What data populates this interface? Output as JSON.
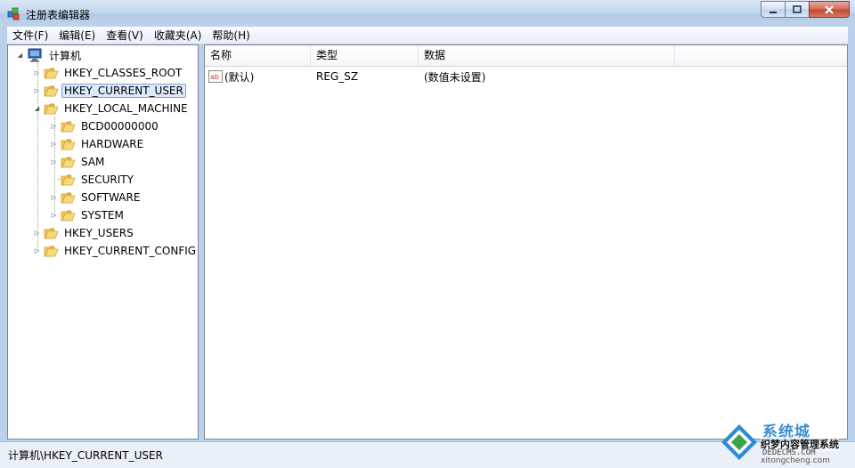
{
  "window": {
    "title": "注册表编辑器",
    "controls": {
      "minimize_icon": "minimize-icon",
      "maximize_icon": "maximize-icon",
      "close_icon": "close-icon"
    }
  },
  "menu": {
    "items": [
      {
        "label": "文件(F)"
      },
      {
        "label": "编辑(E)"
      },
      {
        "label": "查看(V)"
      },
      {
        "label": "收藏夹(A)"
      },
      {
        "label": "帮助(H)"
      }
    ]
  },
  "tree": {
    "root": {
      "label": "计算机",
      "icon": "computer-icon"
    },
    "nodes": [
      {
        "label": "HKEY_CLASSES_ROOT",
        "level": 1,
        "expander": "collapsed"
      },
      {
        "label": "HKEY_CURRENT_USER",
        "level": 1,
        "expander": "collapsed",
        "selected": true
      },
      {
        "label": "HKEY_LOCAL_MACHINE",
        "level": 1,
        "expander": "expanded"
      },
      {
        "label": "BCD00000000",
        "level": 2,
        "expander": "collapsed"
      },
      {
        "label": "HARDWARE",
        "level": 2,
        "expander": "collapsed"
      },
      {
        "label": "SAM",
        "level": 2,
        "expander": "collapsed"
      },
      {
        "label": "SECURITY",
        "level": 2,
        "expander": "none"
      },
      {
        "label": "SOFTWARE",
        "level": 2,
        "expander": "collapsed"
      },
      {
        "label": "SYSTEM",
        "level": 2,
        "expander": "collapsed"
      },
      {
        "label": "HKEY_USERS",
        "level": 1,
        "expander": "collapsed"
      },
      {
        "label": "HKEY_CURRENT_CONFIG",
        "level": 1,
        "expander": "collapsed"
      }
    ]
  },
  "list": {
    "columns": [
      {
        "label": "名称"
      },
      {
        "label": "类型"
      },
      {
        "label": "数据"
      }
    ],
    "rows": [
      {
        "name": "(默认)",
        "type": "REG_SZ",
        "data": "(数值未设置)",
        "icon": "string-value-icon"
      }
    ]
  },
  "status": {
    "path": "计算机\\HKEY_CURRENT_USER"
  },
  "watermark": {
    "line1": "系统城",
    "line2": "织梦内容管理系统",
    "line3": "DEDECMS.COM",
    "line4": "xitongcheng.com"
  },
  "colors": {
    "frame": "#b9d1ea",
    "selection": "#dceafc",
    "folder": "#f0c750"
  }
}
